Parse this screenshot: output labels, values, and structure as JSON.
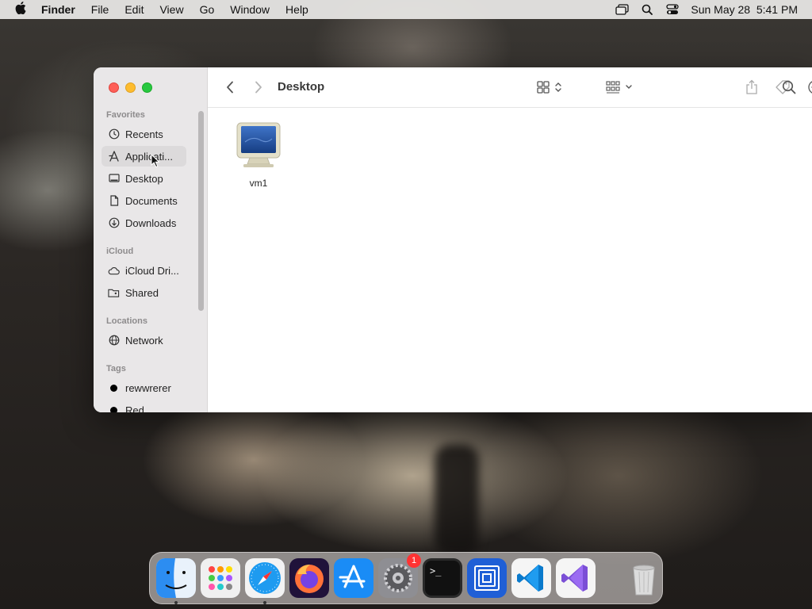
{
  "menubar": {
    "app_name": "Finder",
    "items": [
      "File",
      "Edit",
      "View",
      "Go",
      "Window",
      "Help"
    ],
    "clock": "Sun May 28  5:41 PM"
  },
  "window": {
    "title": "Desktop"
  },
  "sidebar": {
    "favorites_header": "Favorites",
    "favorites": [
      {
        "label": "Recents",
        "icon": "clock-icon"
      },
      {
        "label": "Applicati...",
        "icon": "applications-icon"
      },
      {
        "label": "Desktop",
        "icon": "desktop-icon"
      },
      {
        "label": "Documents",
        "icon": "document-icon"
      },
      {
        "label": "Downloads",
        "icon": "download-icon"
      }
    ],
    "icloud_header": "iCloud",
    "icloud": [
      {
        "label": "iCloud Dri...",
        "icon": "cloud-icon"
      },
      {
        "label": "Shared",
        "icon": "shared-folder-icon"
      }
    ],
    "locations_header": "Locations",
    "locations": [
      {
        "label": "Network",
        "icon": "globe-icon"
      }
    ],
    "tags_header": "Tags",
    "tags": [
      {
        "label": "rewwrerer",
        "color": "#000000"
      },
      {
        "label": "Red",
        "color": "#000000"
      }
    ]
  },
  "files": [
    {
      "name": "vm1",
      "icon": "monitor-icon"
    }
  ],
  "dock": {
    "apps": [
      {
        "name": "Finder",
        "icon": "finder-icon",
        "running": true
      },
      {
        "name": "Launchpad",
        "icon": "launchpad-icon",
        "running": false
      },
      {
        "name": "Safari",
        "icon": "safari-icon",
        "running": true
      },
      {
        "name": "Firefox",
        "icon": "firefox-icon",
        "running": false
      },
      {
        "name": "App Store",
        "icon": "app-store-icon",
        "running": false
      },
      {
        "name": "System Settings",
        "icon": "settings-icon",
        "running": false,
        "badge": "1"
      },
      {
        "name": "Terminal",
        "icon": "terminal-icon",
        "running": false
      },
      {
        "name": "Remote Desktop",
        "icon": "squares-icon",
        "running": false
      },
      {
        "name": "VS Code",
        "icon": "vscode-icon",
        "running": false
      },
      {
        "name": "Visual Studio",
        "icon": "visual-studio-icon",
        "running": false
      }
    ],
    "trash": {
      "name": "Trash",
      "icon": "trash-icon"
    },
    "terminal_glyph": ">_"
  }
}
